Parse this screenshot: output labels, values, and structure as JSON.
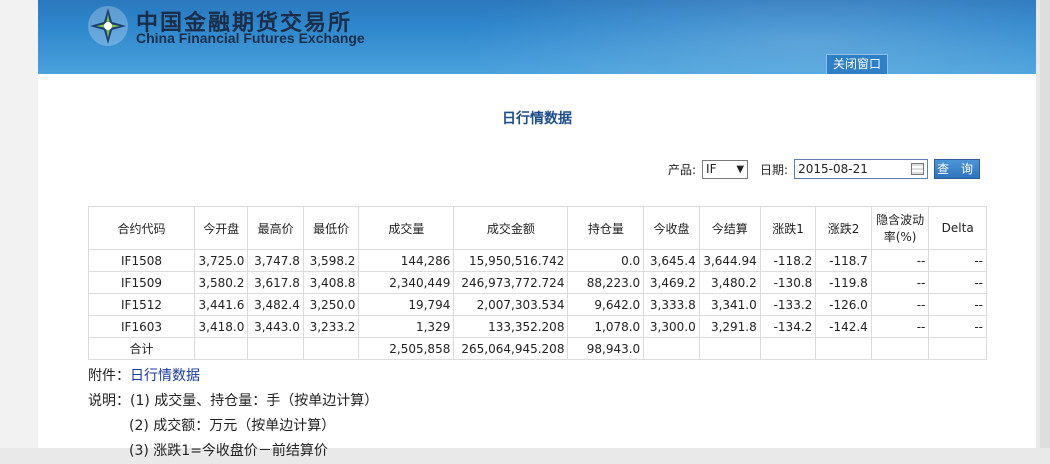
{
  "header": {
    "brand_cn": "中国金融期货交易所",
    "brand_en": "China Financial Futures Exchange",
    "close_label": "关闭窗口"
  },
  "title": "日行情数据",
  "filter": {
    "product_label": "产品:",
    "product_value": "IF",
    "date_label": "日期:",
    "date_value": "2015-08-21",
    "query_label": "查 询"
  },
  "table": {
    "headers": [
      "合约代码",
      "今开盘",
      "最高价",
      "最低价",
      "成交量",
      "成交金额",
      "持仓量",
      "今收盘",
      "今结算",
      "涨跌1",
      "涨跌2",
      "隐含波动率(%)",
      "Delta"
    ],
    "rows": [
      [
        "IF1508",
        "3,725.0",
        "3,747.8",
        "3,598.2",
        "144,286",
        "15,950,516.742",
        "0.0",
        "3,645.4",
        "3,644.94",
        "-118.2",
        "-118.7",
        "--",
        "--"
      ],
      [
        "IF1509",
        "3,580.2",
        "3,617.8",
        "3,408.8",
        "2,340,449",
        "246,973,772.724",
        "88,223.0",
        "3,469.2",
        "3,480.2",
        "-130.8",
        "-119.8",
        "--",
        "--"
      ],
      [
        "IF1512",
        "3,441.6",
        "3,482.4",
        "3,250.0",
        "19,794",
        "2,007,303.534",
        "9,642.0",
        "3,333.8",
        "3,341.0",
        "-133.2",
        "-126.0",
        "--",
        "--"
      ],
      [
        "IF1603",
        "3,418.0",
        "3,443.0",
        "3,233.2",
        "1,329",
        "133,352.208",
        "1,078.0",
        "3,300.0",
        "3,291.8",
        "-134.2",
        "-142.4",
        "--",
        "--"
      ],
      [
        "合计",
        "",
        "",
        "",
        "2,505,858",
        "265,064,945.208",
        "98,943.0",
        "",
        "",
        "",
        "",
        "",
        ""
      ]
    ]
  },
  "notes": {
    "attachment_label": "附件：",
    "attachment_link": "日行情数据",
    "note1": "说明：(1) 成交量、持仓量：手（按单边计算）",
    "note2": "(2) 成交额：万元（按单边计算）",
    "note3": "(3) 涨跌1=今收盘价－前结算价"
  },
  "colors": {
    "header_blue": "#2e86cc",
    "title_blue": "#1f4e8c",
    "link_blue": "#1a3aa0"
  }
}
